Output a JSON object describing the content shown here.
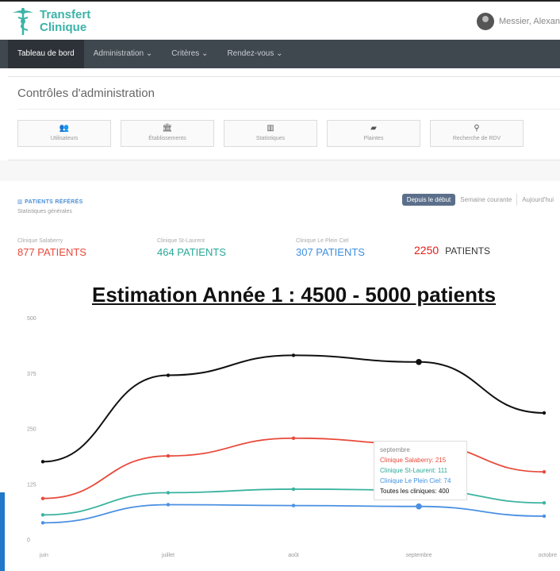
{
  "header": {
    "brand_line1": "Transfert",
    "brand_line2": "Clinique",
    "user_name": "Messier, Alexan"
  },
  "nav": {
    "items": [
      {
        "label": "Tableau de bord",
        "active": true
      },
      {
        "label": "Administration ⌄",
        "active": false
      },
      {
        "label": "Critères ⌄",
        "active": false
      },
      {
        "label": "Rendez-vous ⌄",
        "active": false
      }
    ]
  },
  "admin": {
    "title": "Contrôles d'administration",
    "buttons": [
      {
        "label": "Utilisateurs",
        "icon": "users-icon"
      },
      {
        "label": "Établissements",
        "icon": "institution-icon"
      },
      {
        "label": "Statistiques",
        "icon": "bar-chart-icon"
      },
      {
        "label": "Plaintes",
        "icon": "folder-icon"
      },
      {
        "label": "Recherche de RDV",
        "icon": "search-icon"
      }
    ]
  },
  "patients": {
    "title": "PATIENTS RÉFÉRÉS",
    "subtitle": "Statistiques générales",
    "ranges": [
      "Depuis le début",
      "Semaine courante",
      "Aujourd'hui"
    ],
    "clinics": [
      {
        "name": "Clinique Salaberry",
        "count": "877 PATIENTS",
        "color": "#e8493a"
      },
      {
        "name": "Clinique St-Laurent",
        "count": "464 PATIENTS",
        "color": "#2aa898"
      },
      {
        "name": "Clinique Le Plein Ciel",
        "count": "307 PATIENTS",
        "color": "#3f8fe0"
      }
    ],
    "total_number": "2250",
    "total_label": "PATIENTS"
  },
  "estimation": "Estimation Année 1 : 4500 - 5000 patients",
  "chart_data": {
    "type": "line",
    "categories": [
      "juin",
      "juillet",
      "août",
      "septembre",
      "octobre"
    ],
    "yticks": [
      "0",
      "125",
      "250",
      "375",
      "500"
    ],
    "ylim": [
      0,
      500
    ],
    "series": [
      {
        "name": "Toutes les cliniques",
        "color": "#111111",
        "values": [
          175,
          370,
          415,
          400,
          285
        ]
      },
      {
        "name": "Clinique Salaberry",
        "color": "#e8493a",
        "values": [
          92,
          188,
          228,
          215,
          152
        ]
      },
      {
        "name": "Clinique St-Laurent",
        "color": "#3bb3a0",
        "values": [
          55,
          105,
          113,
          111,
          82
        ]
      },
      {
        "name": "Clinique Le Plein Ciel",
        "color": "#4a90e2",
        "values": [
          37,
          78,
          76,
          74,
          52
        ]
      }
    ],
    "highlight_index": 3
  },
  "tooltip": {
    "title": "septembre",
    "lines": [
      {
        "text": "Clinique Salaberry: 215",
        "color": "#e8493a"
      },
      {
        "text": "Clinique St-Laurent: 111",
        "color": "#2aa898"
      },
      {
        "text": "Clinique Le Plein Ciel: 74",
        "color": "#3f8fe0"
      },
      {
        "text": "Toutes les cliniques: 400",
        "color": "#111111"
      }
    ]
  }
}
